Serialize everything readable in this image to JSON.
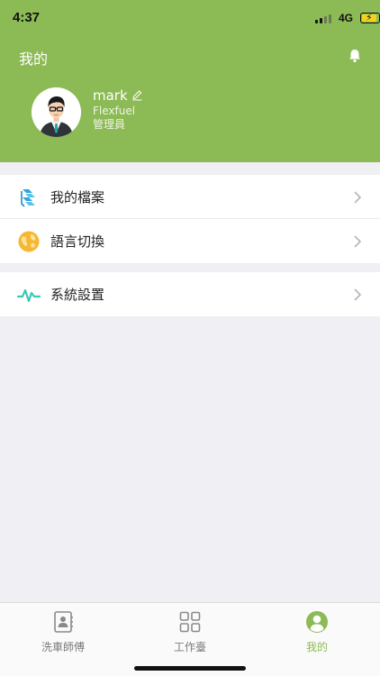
{
  "status_bar": {
    "time": "4:37",
    "network": "4G"
  },
  "header": {
    "title": "我的",
    "accent_color": "#8cba55",
    "icons": [
      "bell-icon",
      "edit-icon"
    ]
  },
  "profile": {
    "name": "mark",
    "company": "Flexfuel",
    "role": "管理員"
  },
  "menu": {
    "group1": [
      {
        "label": "我的檔案",
        "icon": "profile-file-icon"
      },
      {
        "label": "語言切換",
        "icon": "globe-icon"
      }
    ],
    "group2": [
      {
        "label": "系統設置",
        "icon": "pulse-icon"
      }
    ]
  },
  "tabbar": {
    "items": [
      {
        "label": "洗車師傅",
        "icon": "contacts-book-icon",
        "active": false
      },
      {
        "label": "工作臺",
        "icon": "grid-icon",
        "active": false
      },
      {
        "label": "我的",
        "icon": "user-circle-icon",
        "active": true
      }
    ]
  }
}
